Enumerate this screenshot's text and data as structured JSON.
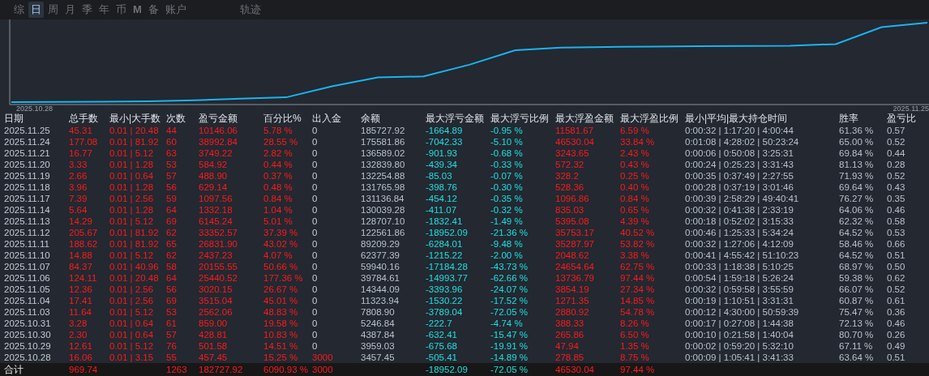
{
  "tabs": [
    {
      "label": "综",
      "selected": false
    },
    {
      "label": "日",
      "selected": true
    },
    {
      "label": "周",
      "selected": false
    },
    {
      "label": "月",
      "selected": false
    },
    {
      "label": "季",
      "selected": false
    },
    {
      "label": "年",
      "selected": false
    },
    {
      "label": "币",
      "selected": false
    },
    {
      "label": "M",
      "selected": false
    },
    {
      "label": "备",
      "selected": false
    },
    {
      "label": "账户",
      "selected": false
    }
  ],
  "track_tab": {
    "label": "轨迹",
    "selected": false
  },
  "chart": {
    "start_label": "2025.10.28",
    "end_label": "2025.11.25"
  },
  "table": {
    "columns": [
      {
        "label": "日期",
        "kind": "plain"
      },
      {
        "label": "总手数",
        "kind": "gain"
      },
      {
        "label": "最小|大手数",
        "kind": "gain"
      },
      {
        "label": "次数",
        "kind": "gain"
      },
      {
        "label": "盈亏金额",
        "kind": "gain"
      },
      {
        "label": "百分比%",
        "kind": "gain"
      },
      {
        "label": "出入金",
        "kind": "deposit"
      },
      {
        "label": "余额",
        "kind": "plain"
      },
      {
        "label": "最大浮亏金额",
        "kind": "loss"
      },
      {
        "label": "最大浮亏比例",
        "kind": "loss"
      },
      {
        "label": "最大浮盈金额",
        "kind": "gain"
      },
      {
        "label": "最大浮盈比例",
        "kind": "gain"
      },
      {
        "label": "最小|平均|最大持仓时间",
        "kind": "plain"
      },
      {
        "label": "胜率",
        "kind": "plain"
      },
      {
        "label": "盈亏比",
        "kind": "plain"
      }
    ],
    "rows": [
      {
        "deposit_in": false,
        "cells": [
          "2025.11.25",
          "45.31",
          "0.01 | 20.48",
          "44",
          "10146.06",
          "5.78 %",
          "0",
          "185727.92",
          "-1664.89",
          "-0.95 %",
          "11581.67",
          "6.59 %",
          "0:00:32 | 1:17:20 | 4:00:44",
          "61.36 %",
          "0.57"
        ]
      },
      {
        "deposit_in": false,
        "cells": [
          "2025.11.24",
          "177.08",
          "0.01 | 81.92",
          "60",
          "38992.84",
          "28.55 %",
          "0",
          "175581.86",
          "-7042.33",
          "-5.10 %",
          "46530.04",
          "33.84 %",
          "0:01:08 | 4:28:02 | 50:23:24",
          "65.00 %",
          "0.52"
        ]
      },
      {
        "deposit_in": false,
        "cells": [
          "2025.11.21",
          "16.77",
          "0.01 | 5.12",
          "63",
          "3749.22",
          "2.82 %",
          "0",
          "136589.02",
          "-901.93",
          "-0.68 %",
          "3243.65",
          "2.43 %",
          "0:00:06 | 0:50:08 | 3:25:31",
          "69.84 %",
          "0.44"
        ]
      },
      {
        "deposit_in": false,
        "cells": [
          "2025.11.20",
          "3.33",
          "0.01 | 1.28",
          "53",
          "584.92",
          "0.44 %",
          "0",
          "132839.80",
          "-439.34",
          "-0.33 %",
          "572.32",
          "0.43 %",
          "0:00:24 | 0:25:23 | 3:31:43",
          "81.13 %",
          "0.28"
        ]
      },
      {
        "deposit_in": false,
        "cells": [
          "2025.11.19",
          "2.66",
          "0.01 | 0.64",
          "57",
          "488.90",
          "0.37 %",
          "0",
          "132254.88",
          "-85.03",
          "-0.07 %",
          "328.2",
          "0.25 %",
          "0:00:35 | 0:37:49 | 2:27:55",
          "71.93 %",
          "0.52"
        ]
      },
      {
        "deposit_in": false,
        "cells": [
          "2025.11.18",
          "3.96",
          "0.01 | 1.28",
          "56",
          "629.14",
          "0.48 %",
          "0",
          "131765.98",
          "-398.76",
          "-0.30 %",
          "528.36",
          "0.40 %",
          "0:00:28 | 0:37:19 | 3:01:46",
          "69.64 %",
          "0.43"
        ]
      },
      {
        "deposit_in": false,
        "cells": [
          "2025.11.17",
          "7.39",
          "0.01 | 2.56",
          "59",
          "1097.56",
          "0.84 %",
          "0",
          "131136.84",
          "-454.12",
          "-0.35 %",
          "1096.86",
          "0.84 %",
          "0:00:39 | 2:58:29 | 49:40:41",
          "76.27 %",
          "0.35"
        ]
      },
      {
        "deposit_in": false,
        "cells": [
          "2025.11.14",
          "5.64",
          "0.01 | 1.28",
          "64",
          "1332.18",
          "1.04 %",
          "0",
          "130039.28",
          "-411.07",
          "-0.32 %",
          "835.03",
          "0.65 %",
          "0:00:32 | 0:41:38 | 2:33:19",
          "64.06 %",
          "0.46"
        ]
      },
      {
        "deposit_in": false,
        "cells": [
          "2025.11.13",
          "14.29",
          "0.01 | 5.12",
          "69",
          "6145.24",
          "5.01 %",
          "0",
          "128707.10",
          "-1832.41",
          "-1.49 %",
          "5395.08",
          "4.39 %",
          "0:00:18 | 0:52:02 | 3:15:33",
          "62.32 %",
          "0.58"
        ]
      },
      {
        "deposit_in": false,
        "cells": [
          "2025.11.12",
          "205.67",
          "0.01 | 81.92",
          "62",
          "33352.57",
          "37.39 %",
          "0",
          "122561.86",
          "-18952.09",
          "-21.36 %",
          "35753.17",
          "40.52 %",
          "0:00:46 | 1:25:33 | 5:34:24",
          "64.52 %",
          "0.53"
        ]
      },
      {
        "deposit_in": false,
        "cells": [
          "2025.11.11",
          "188.62",
          "0.01 | 81.92",
          "65",
          "26831.90",
          "43.02 %",
          "0",
          "89209.29",
          "-6284.01",
          "-9.48 %",
          "35287.97",
          "53.82 %",
          "0:00:32 | 1:27:06 | 4:12:09",
          "58.46 %",
          "0.66"
        ]
      },
      {
        "deposit_in": false,
        "cells": [
          "2025.11.10",
          "14.88",
          "0.01 | 5.12",
          "62",
          "2437.23",
          "4.07 %",
          "0",
          "62377.39",
          "-1215.22",
          "-2.00 %",
          "2048.62",
          "3.38 %",
          "0:00:41 | 4:55:42 | 51:10:23",
          "64.52 %",
          "0.51"
        ]
      },
      {
        "deposit_in": false,
        "cells": [
          "2025.11.07",
          "84.37",
          "0.01 | 40.96",
          "58",
          "20155.55",
          "50.66 %",
          "0",
          "59940.16",
          "-17184.28",
          "-43.73 %",
          "24654.64",
          "62.75 %",
          "0:00:33 | 1:18:38 | 5:10:25",
          "68.97 %",
          "0.50"
        ]
      },
      {
        "deposit_in": false,
        "cells": [
          "2025.11.06",
          "124.11",
          "0.01 | 20.48",
          "64",
          "25440.52",
          "177.36 %",
          "0",
          "39784.61",
          "-14993.77",
          "-62.66 %",
          "13736.79",
          "97.44 %",
          "0:00:54 | 1:59:18 | 5:26:24",
          "59.38 %",
          "0.62"
        ]
      },
      {
        "deposit_in": false,
        "cells": [
          "2025.11.05",
          "12.36",
          "0.01 | 2.56",
          "56",
          "3020.15",
          "26.67 %",
          "0",
          "14344.09",
          "-3393.96",
          "-24.07 %",
          "3854.19",
          "27.34 %",
          "0:00:32 | 0:59:58 | 3:55:59",
          "66.07 %",
          "0.52"
        ]
      },
      {
        "deposit_in": false,
        "cells": [
          "2025.11.04",
          "17.41",
          "0.01 | 2.56",
          "69",
          "3515.04",
          "45.01 %",
          "0",
          "11323.94",
          "-1530.22",
          "-17.52 %",
          "1271.35",
          "14.85 %",
          "0:00:19 | 1:10:51 | 3:31:31",
          "60.87 %",
          "0.61"
        ]
      },
      {
        "deposit_in": false,
        "cells": [
          "2025.11.03",
          "11.64",
          "0.01 | 5.12",
          "53",
          "2562.06",
          "48.83 %",
          "0",
          "7808.90",
          "-3789.04",
          "-72.05 %",
          "2880.92",
          "54.78 %",
          "0:00:12 | 4:30:00 | 50:59:39",
          "75.47 %",
          "0.36"
        ]
      },
      {
        "deposit_in": false,
        "cells": [
          "2025.10.31",
          "3.28",
          "0.01 | 0.64",
          "61",
          "859.00",
          "19.58 %",
          "0",
          "5246.84",
          "-222.7",
          "-4.74 %",
          "388.33",
          "8.26 %",
          "0:00:17 | 0:27:08 | 1:44:38",
          "72.13 %",
          "0.46"
        ]
      },
      {
        "deposit_in": false,
        "cells": [
          "2025.10.30",
          "2.30",
          "0.01 | 0.64",
          "57",
          "428.81",
          "10.83 %",
          "0",
          "4387.84",
          "-632.41",
          "-15.47 %",
          "265.86",
          "6.50 %",
          "0:00:10 | 0:21:58 | 1:40:04",
          "80.70 %",
          "0.26"
        ]
      },
      {
        "deposit_in": false,
        "cells": [
          "2025.10.29",
          "12.61",
          "0.01 | 5.12",
          "76",
          "501.58",
          "14.51 %",
          "0",
          "3959.03",
          "-675.68",
          "-19.91 %",
          "47.94",
          "1.35 %",
          "0:00:02 | 0:59:20 | 5:32:10",
          "67.11 %",
          "0.49"
        ]
      },
      {
        "deposit_in": true,
        "cells": [
          "2025.10.28",
          "16.06",
          "0.01 | 3.15",
          "55",
          "457.45",
          "15.25 %",
          "3000",
          "3457.45",
          "-505.41",
          "-14.89 %",
          "278.85",
          "8.75 %",
          "0:00:09 | 1:05:41 | 3:41:33",
          "63.64 %",
          "0.51"
        ]
      }
    ],
    "total": {
      "deposit_in": true,
      "cells": [
        "合计",
        "969.74",
        null,
        "1263",
        "182727.92",
        "6090.93 %",
        "3000",
        null,
        "-18952.09",
        "-72.05 %",
        "46530.04",
        "97.44 %",
        null,
        null,
        null
      ]
    }
  }
}
